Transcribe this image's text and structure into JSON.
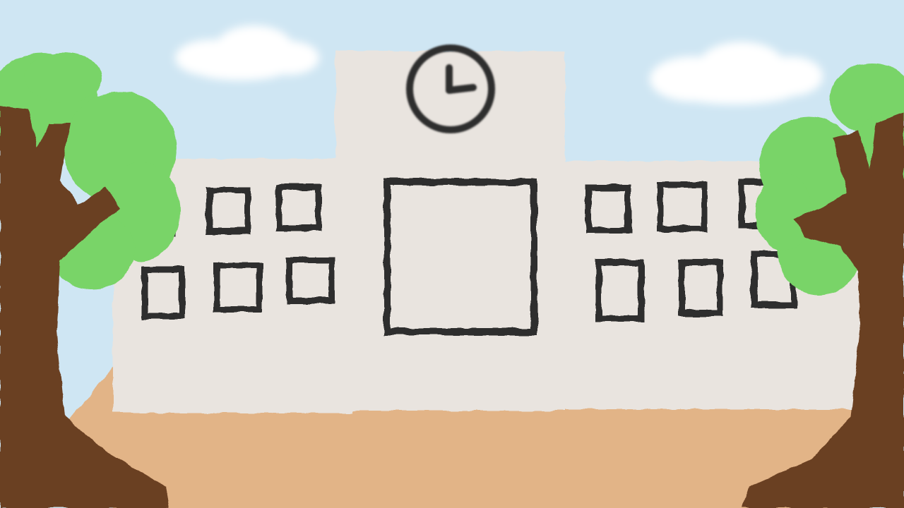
{
  "scene": {
    "colors": {
      "sky": "#cfe6f3",
      "cloud": "#ffffff",
      "building": "#e9e4df",
      "ground": "#e2b487",
      "outline": "#2f2d2e",
      "trunk": "#6b3f22",
      "foliage": "#79d467",
      "foliage_dark": "#5ec24e"
    },
    "icons": [
      "clock-icon"
    ]
  }
}
